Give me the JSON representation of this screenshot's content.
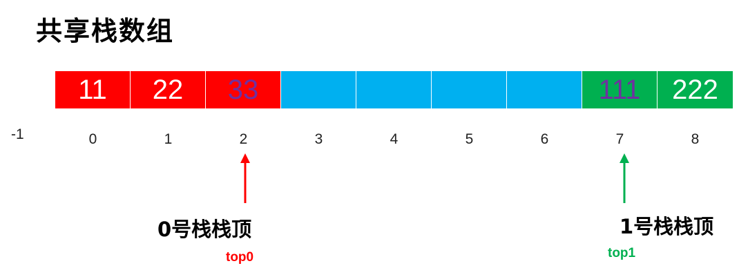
{
  "title": "共享栈数组",
  "colors": {
    "stack0_fill": "#ff0000",
    "empty_fill": "#00b0f0",
    "stack1_fill": "#00b050",
    "text_white": "#ffffff",
    "text_top": "#7030a0",
    "arrow0": "#ff0000",
    "arrow1": "#00b050"
  },
  "cells": [
    {
      "value": "11",
      "owner": "stack0"
    },
    {
      "value": "22",
      "owner": "stack0"
    },
    {
      "value": "33",
      "owner": "stack0",
      "is_top": true
    },
    {
      "value": "",
      "owner": "empty"
    },
    {
      "value": "",
      "owner": "empty"
    },
    {
      "value": "",
      "owner": "empty"
    },
    {
      "value": "",
      "owner": "empty"
    },
    {
      "value": "111",
      "owner": "stack1",
      "is_top": true
    },
    {
      "value": "222",
      "owner": "stack1"
    }
  ],
  "indices": [
    "0",
    "1",
    "2",
    "3",
    "4",
    "5",
    "6",
    "7",
    "8"
  ],
  "neg_index": "-1",
  "stack0": {
    "label": "0号栈栈顶",
    "pointer": "top0",
    "index": 2
  },
  "stack1": {
    "label": "1号栈栈顶",
    "pointer": "top1",
    "index": 7
  }
}
